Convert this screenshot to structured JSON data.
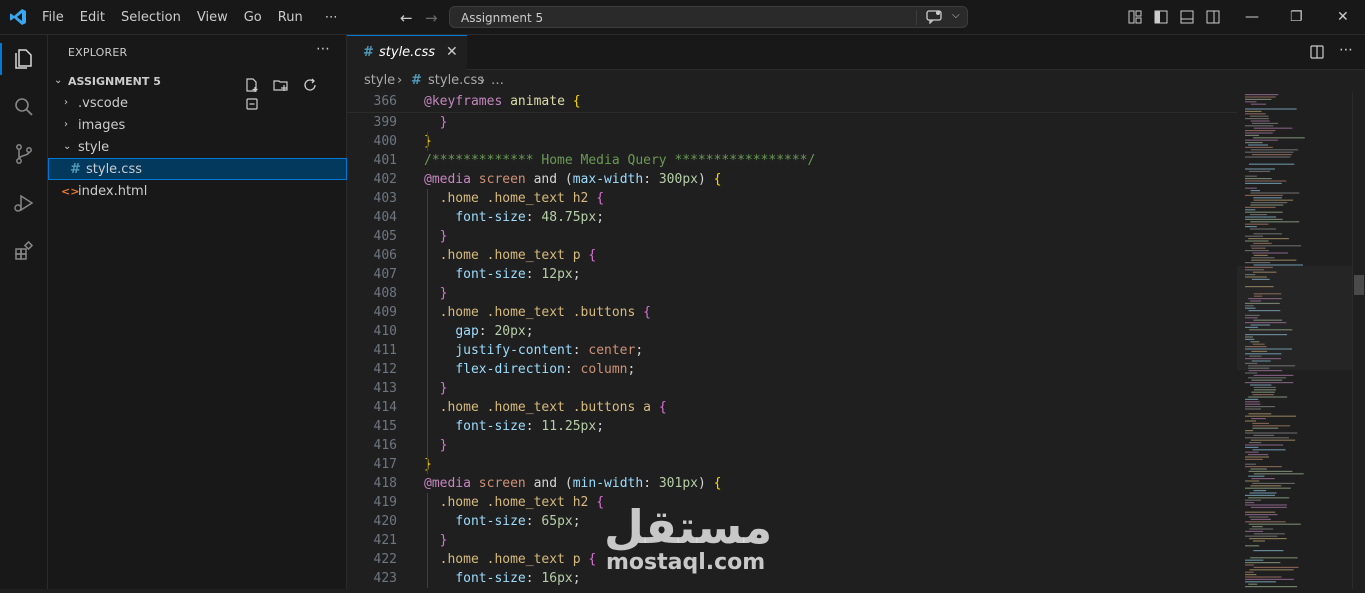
{
  "menu": [
    "File",
    "Edit",
    "Selection",
    "View",
    "Go",
    "Run",
    "⋯"
  ],
  "command_center": {
    "text": "Assignment 5"
  },
  "explorer": {
    "header": "EXPLORER",
    "more": "⋯",
    "section": "ASSIGNMENT 5",
    "items": [
      {
        "label": ".vscode"
      },
      {
        "label": "images"
      },
      {
        "label": "style"
      },
      {
        "label": "style.css"
      },
      {
        "label": "index.html"
      }
    ]
  },
  "tab": {
    "label": "style.css",
    "close": "✕",
    "icon": "#"
  },
  "breadcrumb": [
    "style",
    "#",
    "style.css",
    "…"
  ],
  "lines": [
    {
      "n": "366",
      "segs": [
        [
          "k-at",
          "@keyframes"
        ],
        [
          "k-plain",
          " "
        ],
        [
          "k-name",
          "animate"
        ],
        [
          "k-plain",
          " "
        ],
        [
          "k-br",
          "{"
        ]
      ]
    },
    {
      "n": "399",
      "segs": [
        [
          "k-plain",
          "  "
        ],
        [
          "k-br2",
          "}"
        ]
      ]
    },
    {
      "n": "400",
      "segs": [
        [
          "k-br",
          "}"
        ]
      ]
    },
    {
      "n": "401",
      "segs": [
        [
          "k-comment",
          "/************* Home Media Query *****************/"
        ]
      ]
    },
    {
      "n": "402",
      "segs": [
        [
          "k-at",
          "@media"
        ],
        [
          "k-plain",
          " "
        ],
        [
          "k-val",
          "screen"
        ],
        [
          "k-plain",
          " and "
        ],
        [
          "k-plain",
          "("
        ],
        [
          "k-prop",
          "max-width"
        ],
        [
          "k-plain",
          ": "
        ],
        [
          "k-num",
          "300px"
        ],
        [
          "k-plain",
          ") "
        ],
        [
          "k-br",
          "{"
        ]
      ]
    },
    {
      "n": "403",
      "segs": [
        [
          "k-plain",
          "  "
        ],
        [
          "k-sel",
          ".home .home_text h2"
        ],
        [
          "k-plain",
          " "
        ],
        [
          "k-br2",
          "{"
        ]
      ]
    },
    {
      "n": "404",
      "segs": [
        [
          "k-plain",
          "    "
        ],
        [
          "k-prop",
          "font-size"
        ],
        [
          "k-plain",
          ": "
        ],
        [
          "k-num",
          "48.75px"
        ],
        [
          "k-plain",
          ";"
        ]
      ]
    },
    {
      "n": "405",
      "segs": [
        [
          "k-plain",
          "  "
        ],
        [
          "k-br2",
          "}"
        ]
      ]
    },
    {
      "n": "406",
      "segs": [
        [
          "k-plain",
          "  "
        ],
        [
          "k-sel",
          ".home .home_text p"
        ],
        [
          "k-plain",
          " "
        ],
        [
          "k-br2",
          "{"
        ]
      ]
    },
    {
      "n": "407",
      "segs": [
        [
          "k-plain",
          "    "
        ],
        [
          "k-prop",
          "font-size"
        ],
        [
          "k-plain",
          ": "
        ],
        [
          "k-num",
          "12px"
        ],
        [
          "k-plain",
          ";"
        ]
      ]
    },
    {
      "n": "408",
      "segs": [
        [
          "k-plain",
          "  "
        ],
        [
          "k-br2",
          "}"
        ]
      ]
    },
    {
      "n": "409",
      "segs": [
        [
          "k-plain",
          "  "
        ],
        [
          "k-sel",
          ".home .home_text .buttons"
        ],
        [
          "k-plain",
          " "
        ],
        [
          "k-br2",
          "{"
        ]
      ]
    },
    {
      "n": "410",
      "segs": [
        [
          "k-plain",
          "    "
        ],
        [
          "k-prop",
          "gap"
        ],
        [
          "k-plain",
          ": "
        ],
        [
          "k-num",
          "20px"
        ],
        [
          "k-plain",
          ";"
        ]
      ]
    },
    {
      "n": "411",
      "segs": [
        [
          "k-plain",
          "    "
        ],
        [
          "k-prop",
          "justify-content"
        ],
        [
          "k-plain",
          ": "
        ],
        [
          "k-val",
          "center"
        ],
        [
          "k-plain",
          ";"
        ]
      ]
    },
    {
      "n": "412",
      "segs": [
        [
          "k-plain",
          "    "
        ],
        [
          "k-prop",
          "flex-direction"
        ],
        [
          "k-plain",
          ": "
        ],
        [
          "k-val",
          "column"
        ],
        [
          "k-plain",
          ";"
        ]
      ]
    },
    {
      "n": "413",
      "segs": [
        [
          "k-plain",
          "  "
        ],
        [
          "k-br2",
          "}"
        ]
      ]
    },
    {
      "n": "414",
      "segs": [
        [
          "k-plain",
          "  "
        ],
        [
          "k-sel",
          ".home .home_text .buttons a"
        ],
        [
          "k-plain",
          " "
        ],
        [
          "k-br2",
          "{"
        ]
      ]
    },
    {
      "n": "415",
      "segs": [
        [
          "k-plain",
          "    "
        ],
        [
          "k-prop",
          "font-size"
        ],
        [
          "k-plain",
          ": "
        ],
        [
          "k-num",
          "11.25px"
        ],
        [
          "k-plain",
          ";"
        ]
      ]
    },
    {
      "n": "416",
      "segs": [
        [
          "k-plain",
          "  "
        ],
        [
          "k-br2",
          "}"
        ]
      ]
    },
    {
      "n": "417",
      "segs": [
        [
          "k-br",
          "}"
        ]
      ]
    },
    {
      "n": "418",
      "segs": [
        [
          "k-at",
          "@media"
        ],
        [
          "k-plain",
          " "
        ],
        [
          "k-val",
          "screen"
        ],
        [
          "k-plain",
          " and "
        ],
        [
          "k-plain",
          "("
        ],
        [
          "k-prop",
          "min-width"
        ],
        [
          "k-plain",
          ": "
        ],
        [
          "k-num",
          "301px"
        ],
        [
          "k-plain",
          ") "
        ],
        [
          "k-br",
          "{"
        ]
      ]
    },
    {
      "n": "419",
      "segs": [
        [
          "k-plain",
          "  "
        ],
        [
          "k-sel",
          ".home .home_text h2"
        ],
        [
          "k-plain",
          " "
        ],
        [
          "k-br2",
          "{"
        ]
      ]
    },
    {
      "n": "420",
      "segs": [
        [
          "k-plain",
          "    "
        ],
        [
          "k-prop",
          "font-size"
        ],
        [
          "k-plain",
          ": "
        ],
        [
          "k-num",
          "65px"
        ],
        [
          "k-plain",
          ";"
        ]
      ]
    },
    {
      "n": "421",
      "segs": [
        [
          "k-plain",
          "  "
        ],
        [
          "k-br2",
          "}"
        ]
      ]
    },
    {
      "n": "422",
      "segs": [
        [
          "k-plain",
          "  "
        ],
        [
          "k-sel",
          ".home .home_text p"
        ],
        [
          "k-plain",
          " "
        ],
        [
          "k-br2",
          "{"
        ]
      ]
    },
    {
      "n": "423",
      "segs": [
        [
          "k-plain",
          "    "
        ],
        [
          "k-prop",
          "font-size"
        ],
        [
          "k-plain",
          ": "
        ],
        [
          "k-num",
          "16px"
        ],
        [
          "k-plain",
          ";"
        ]
      ]
    }
  ],
  "watermark": {
    "arabic": "مستقل",
    "latin": "mostaql.com"
  }
}
